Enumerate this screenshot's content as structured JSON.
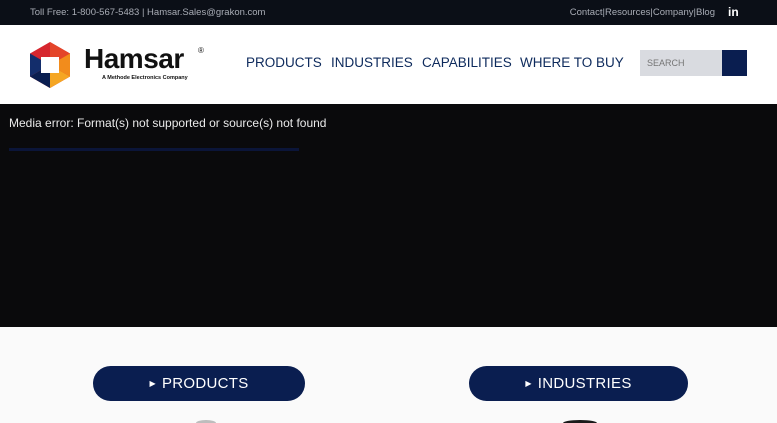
{
  "topbar": {
    "contact_line": "Toll Free: 1-800-567-5483 | Hamsar.Sales@grakon.com",
    "links": [
      "Contact",
      "Resources",
      "Company",
      "Blog"
    ],
    "separator": "|",
    "social": "in"
  },
  "header": {
    "logo_word": "Hamsar",
    "logo_reg": "®",
    "logo_tagline": "A Methode Electronics Company",
    "nav": [
      "PRODUCTS",
      "INDUSTRIES",
      "CAPABILITIES",
      "WHERE TO BUY"
    ],
    "search_placeholder": "SEARCH"
  },
  "media": {
    "error_text": "Media error: Format(s) not supported or source(s) not found"
  },
  "buttons": {
    "products": "PRODUCTS",
    "industries": "INDUSTRIES"
  },
  "colors": {
    "navy": "#0a1e50",
    "topbar_bg": "#0b0f17",
    "logo_red": "#d6262e",
    "logo_orange": "#f28c1c",
    "logo_blue": "#0a1e50"
  }
}
